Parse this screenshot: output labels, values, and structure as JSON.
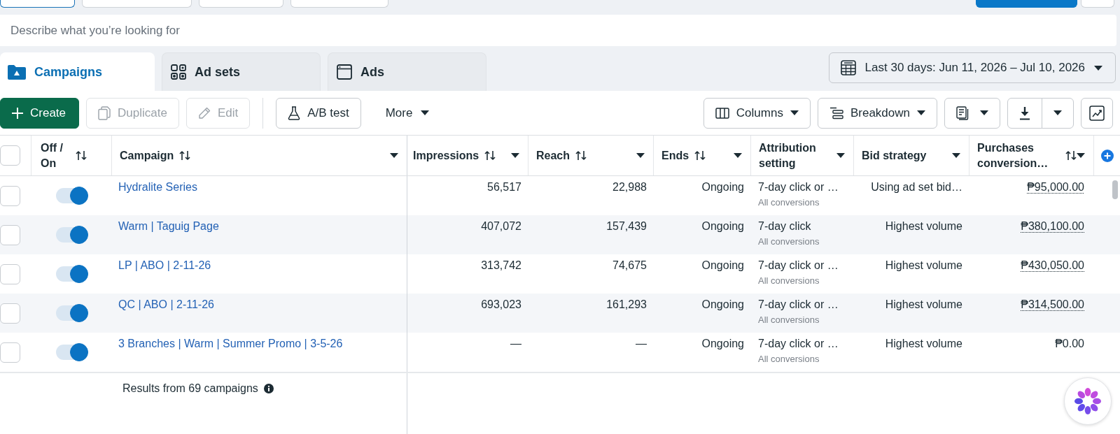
{
  "top_bar": {
    "left_buttons": [
      {
        "selected": true
      },
      {
        "selected": false
      },
      {
        "selected": false
      },
      {
        "selected": false
      }
    ],
    "right_buttons": [
      {
        "kind": "primary"
      },
      {
        "kind": "secondary"
      }
    ]
  },
  "search": {
    "placeholder": "Describe what you’re looking for"
  },
  "tabs": [
    {
      "label": "Campaigns",
      "selected": true
    },
    {
      "label": "Ad sets",
      "selected": false
    },
    {
      "label": "Ads",
      "selected": false
    }
  ],
  "date_range": {
    "label": "Last 30 days: Jun 11, 2026 – Jul 10, 2026"
  },
  "toolbar": {
    "left": [
      {
        "kind": "primary",
        "label": "Create",
        "disabled": false
      },
      {
        "kind": "outline",
        "label": "Duplicate",
        "disabled": true
      },
      {
        "kind": "outline",
        "label": "Edit",
        "disabled": true
      },
      {
        "kind": "outline",
        "label": "A/B test",
        "disabled": false
      },
      {
        "kind": "menu",
        "label": "More",
        "disabled": false
      }
    ],
    "right": [
      {
        "kind": "menu",
        "label": "Columns"
      },
      {
        "kind": "menu",
        "label": "Breakdown"
      },
      {
        "kind": "icon_menu"
      },
      {
        "kind": "split"
      },
      {
        "kind": "icon"
      }
    ]
  },
  "table": {
    "select_all": {
      "checked": false
    },
    "columns": [
      {
        "label": "Off / On",
        "sortable": true,
        "menu": false
      },
      {
        "label": "Campaign",
        "sortable": true,
        "menu": true
      },
      {
        "label": "Impressions",
        "sortable": true,
        "menu": true
      },
      {
        "label": "Reach",
        "sortable": true,
        "menu": true
      },
      {
        "label": "Ends",
        "sortable": true,
        "menu": true
      },
      {
        "label": "Attribution setting",
        "sortable": false,
        "menu": true
      },
      {
        "label": "Bid strategy",
        "sortable": false,
        "menu": true
      },
      {
        "label": "Purchases conversion…",
        "sortable": true,
        "menu": true
      }
    ],
    "rows": [
      {
        "checked": false,
        "on": true,
        "campaign": "Hydralite Series",
        "impressions": "56,517",
        "reach": "22,988",
        "ends": "Ongoing",
        "attribution": "7-day click or …",
        "attribution_detail": "All conversions",
        "bid_strategy": "Using ad set bid…",
        "purchases_value": "₱95,000.00",
        "underlined": true
      },
      {
        "checked": false,
        "on": true,
        "campaign": "Warm | Taguig Page",
        "impressions": "407,072",
        "reach": "157,439",
        "ends": "Ongoing",
        "attribution": "7-day click",
        "attribution_detail": "All conversions",
        "bid_strategy": "Highest volume",
        "purchases_value": "₱380,100.00",
        "underlined": true
      },
      {
        "checked": false,
        "on": true,
        "campaign": "LP | ABO | 2-11-26",
        "impressions": "313,742",
        "reach": "74,675",
        "ends": "Ongoing",
        "attribution": "7-day click or …",
        "attribution_detail": "All conversions",
        "bid_strategy": "Highest volume",
        "purchases_value": "₱430,050.00",
        "underlined": true
      },
      {
        "checked": false,
        "on": true,
        "campaign": "QC | ABO | 2-11-26",
        "impressions": "693,023",
        "reach": "161,293",
        "ends": "Ongoing",
        "attribution": "7-day click or …",
        "attribution_detail": "All conversions",
        "bid_strategy": "Highest volume",
        "purchases_value": "₱314,500.00",
        "underlined": true
      },
      {
        "checked": false,
        "on": true,
        "campaign": "3 Branches | Warm | Summer Promo | 3-5-26",
        "impressions": "—",
        "reach": "—",
        "ends": "Ongoing",
        "attribution": "7-day click or …",
        "attribution_detail": "All conversions",
        "bid_strategy": "Highest volume",
        "purchases_value": "₱0.00",
        "underlined": false
      }
    ]
  },
  "footer": {
    "results": "Results from 69 campaigns"
  }
}
